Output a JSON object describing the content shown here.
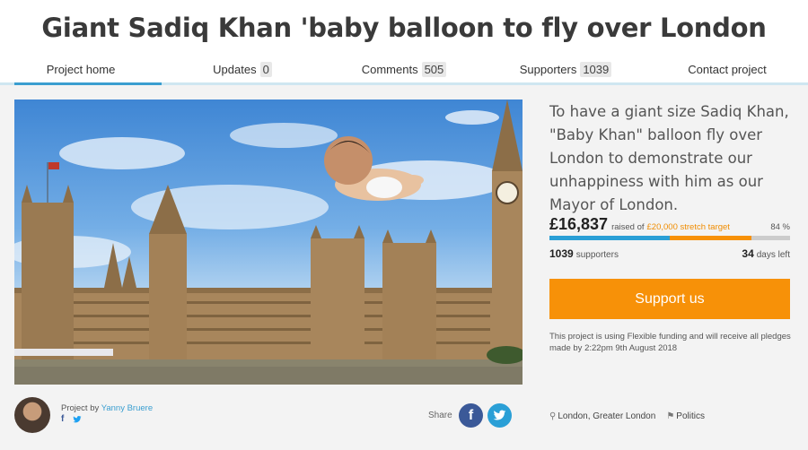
{
  "page": {
    "title": "Giant Sadiq Khan 'baby balloon to fly over London"
  },
  "tabs": [
    {
      "label": "Project home",
      "count": null,
      "active": true
    },
    {
      "label": "Updates",
      "count": "0",
      "active": false
    },
    {
      "label": "Comments",
      "count": "505",
      "active": false
    },
    {
      "label": "Supporters",
      "count": "1039",
      "active": false
    },
    {
      "label": "Contact project",
      "count": null,
      "active": false
    }
  ],
  "hero": {
    "image_description_icon": "houses-of-parliament-with-baby-balloon-image"
  },
  "description": "To have a giant size Sadiq Khan, \"Baby Khan\" balloon fly over London to demonstrate our unhappiness with him as our Mayor of London.",
  "funding": {
    "raised": "£16,837",
    "raised_of": "raised of",
    "target": "£20,000 stretch target",
    "percent_label": "84 %",
    "percent": 84,
    "primary_target_fraction": 0.5,
    "supporters_count": "1039",
    "supporters_label": "supporters",
    "days_count": "34",
    "days_label": "days left",
    "support_button": "Support us",
    "note": "This project is using Flexible funding and will receive all pledges made by 2:22pm 9th August 2018"
  },
  "owner": {
    "by_label": "Project by",
    "name": "Yanny Bruere",
    "links_icons": [
      "facebook-icon",
      "twitter-icon"
    ]
  },
  "share": {
    "label": "Share"
  },
  "meta": {
    "location": "London, Greater London",
    "category": "Politics"
  },
  "colors": {
    "accent_blue": "#3a9ed0",
    "accent_orange": "#f79108",
    "facebook": "#3b5998",
    "twitter": "#2a9fd6"
  }
}
